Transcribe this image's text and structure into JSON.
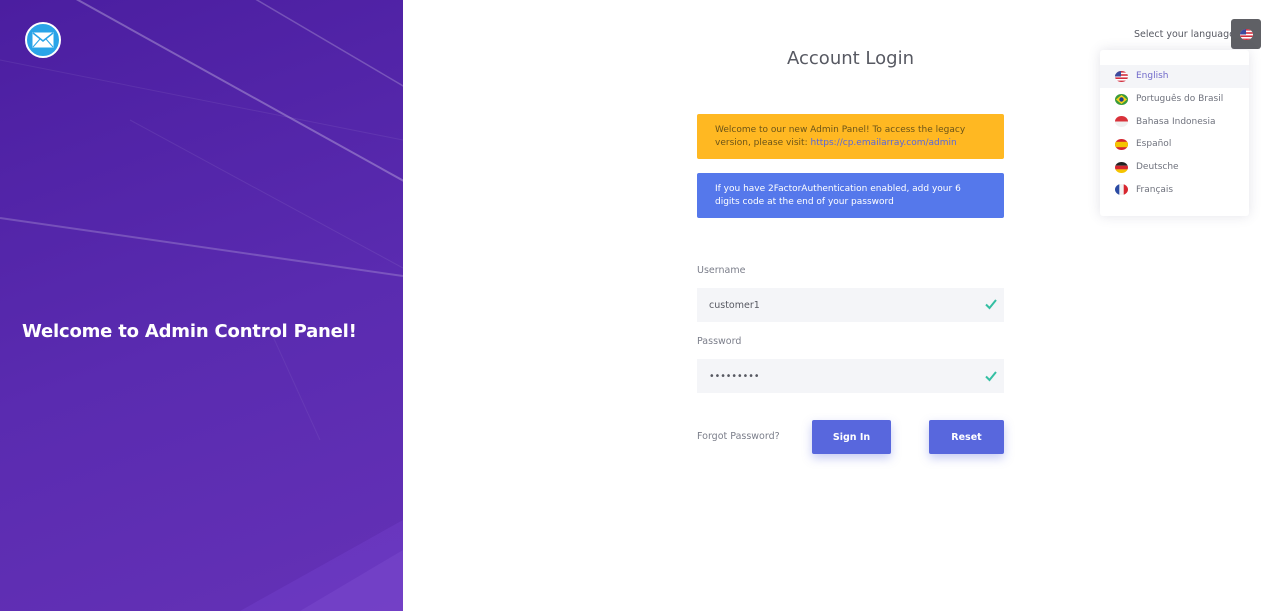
{
  "left_panel": {
    "welcome_title": "Welcome to Admin Control Panel!",
    "logo_icon": "mail-icon"
  },
  "language": {
    "label": "Select your language.",
    "current_flag": "us-flag-icon",
    "options": [
      {
        "label": "English",
        "flag": "us-flag-icon",
        "active": true
      },
      {
        "label": "Português do Brasil",
        "flag": "brazil-flag-icon",
        "active": false
      },
      {
        "label": "Bahasa Indonesia",
        "flag": "indonesia-flag-icon",
        "active": false
      },
      {
        "label": "Español",
        "flag": "spain-flag-icon",
        "active": false
      },
      {
        "label": "Deutsche",
        "flag": "germany-flag-icon",
        "active": false
      },
      {
        "label": "Français",
        "flag": "france-flag-icon",
        "active": false
      }
    ]
  },
  "login": {
    "title": "Account Login",
    "legacy_notice": "Welcome to our new Admin Panel! To access the legacy version, please visit:",
    "legacy_link": "https://cp.emailarray.com/admin",
    "twofa_notice": "If you have 2FactorAuthentication enabled, add your 6 digits code at the end of your password",
    "username_label": "Username",
    "username_value": "customer1",
    "password_label": "Password",
    "password_value": "•••••••••",
    "forgot_label": "Forgot Password?",
    "signin_label": "Sign In",
    "reset_label": "Reset"
  },
  "colors": {
    "accent": "#5867dd",
    "warning": "#ffb822",
    "info": "#5578eb",
    "success": "#34bfa3",
    "panel": "#4b1ea0"
  }
}
